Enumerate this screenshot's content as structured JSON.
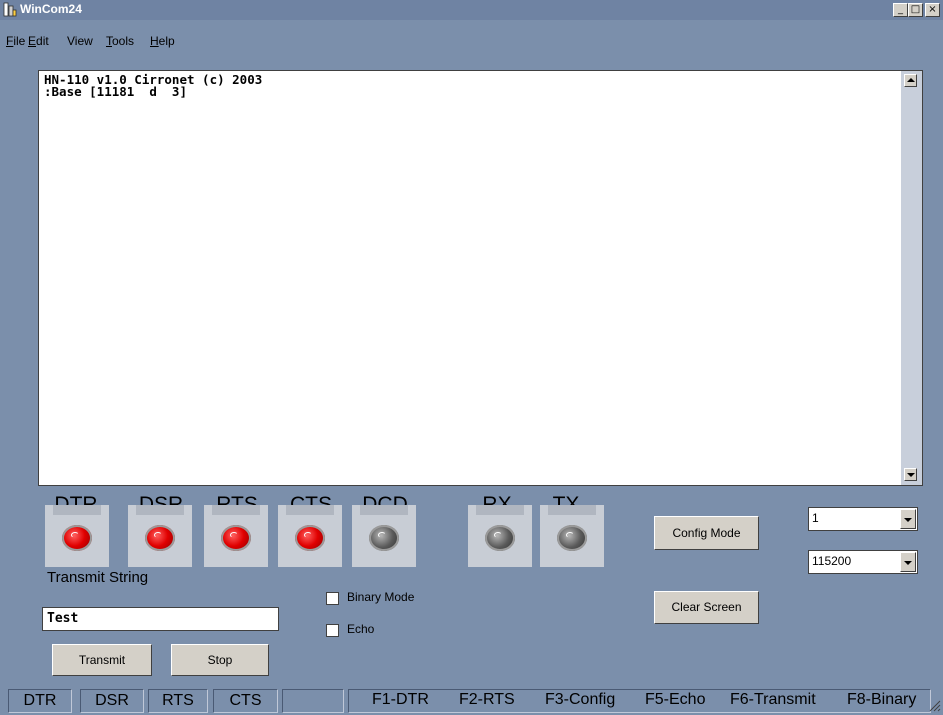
{
  "window": {
    "title": "WinCom24",
    "minimize_label": "_",
    "maximize_label": "□",
    "close_label": "×"
  },
  "menu": {
    "items": [
      {
        "label_ul": "F",
        "label_rest": "ile"
      },
      {
        "label_ul": "E",
        "label_rest": "dit"
      },
      {
        "label_ul": "",
        "label_rest": "View"
      },
      {
        "label_ul": "T",
        "label_rest": "ools"
      },
      {
        "label_ul": "H",
        "label_rest": "elp"
      }
    ]
  },
  "terminal": {
    "text": "HN-110 v1.0 Cirronet (c) 2003\n:Base [11181  d  3]"
  },
  "leds": [
    {
      "label": "DTR",
      "state": "red"
    },
    {
      "label": "DSR",
      "state": "red"
    },
    {
      "label": "RTS",
      "state": "red"
    },
    {
      "label": "CTS",
      "state": "red"
    },
    {
      "label": "DCD",
      "state": "gray"
    },
    {
      "label": "RX",
      "state": "gray"
    },
    {
      "label": "TX",
      "state": "gray"
    }
  ],
  "transmit": {
    "label": "Transmit String",
    "value": "Test",
    "transmit_button": "Transmit",
    "stop_button": "Stop"
  },
  "options": {
    "binary_mode": "Binary Mode",
    "echo": "Echo"
  },
  "buttons": {
    "config_mode": "Config Mode",
    "clear_screen": "Clear Screen"
  },
  "port_select": {
    "value": "1"
  },
  "baud_select": {
    "value": "115200"
  },
  "statusbar": {
    "cells": [
      "DTR",
      "DSR",
      "RTS",
      "CTS",
      ""
    ],
    "keys": [
      "F1-DTR",
      "F2-RTS",
      "F3-Config",
      "F5-Echo",
      "F6-Transmit",
      "F8-Binary"
    ]
  },
  "colors": {
    "background": "#7b8fab",
    "led_on": "#e00000",
    "led_off": "#5a5a5a"
  }
}
